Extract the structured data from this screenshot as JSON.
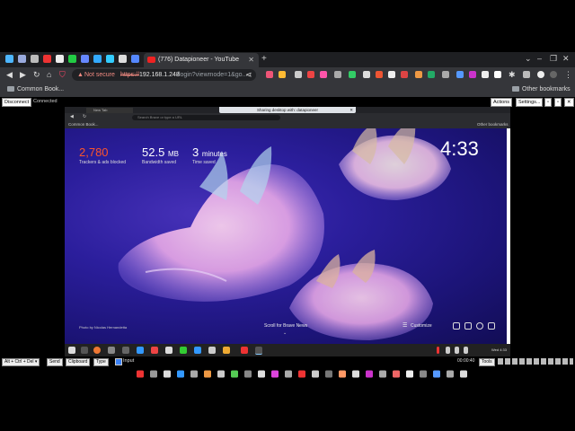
{
  "browser": {
    "active_tab_title": "(776) Datapioneer - YouTube",
    "address": {
      "warning": "Not secure",
      "scheme": "https://",
      "host": "192.168.1.248",
      "path": "/login?viewmode=1&go..."
    },
    "bookmarks": {
      "left_folder": "Common Book...",
      "right_folder": "Other bookmarks"
    }
  },
  "remote_toolbar": {
    "disconnect": "Disconnect",
    "status": "Connected",
    "actions": "Actions",
    "settings": "Settings..."
  },
  "remote": {
    "tab_title": "New Tab",
    "omnibox_placeholder": "Search Brave or type a URL",
    "sharing_banner": "Sharing desktop with: datapioneer",
    "bookmarks_left": "Common Book...",
    "bookmarks_right": "Other bookmarks",
    "stats": {
      "trackers_value": "2,780",
      "trackers_label": "Trackers & ads blocked",
      "bandwidth_value": "52.5",
      "bandwidth_unit": "MB",
      "bandwidth_label": "Bandwidth saved",
      "time_value": "3",
      "time_unit": "minutes",
      "time_label": "Time saved"
    },
    "clock": "4:33",
    "photo_credit": "Photo by Nicolas Hernandetta",
    "scroll_news": "Scroll for Brave News",
    "customize": "Customize",
    "taskbar_clock": "Wed 4:33"
  },
  "bottom_bar": {
    "key_combo": "Alt + Ctrl + Del",
    "send": "Send",
    "clipboard": "Clipboard",
    "type": "Type",
    "input_label": "Input",
    "timer": "00:00:40",
    "tools": "Tools"
  },
  "colors": {
    "accent_red": "#fb542b",
    "wallpaper_deep": "#1c1478"
  }
}
